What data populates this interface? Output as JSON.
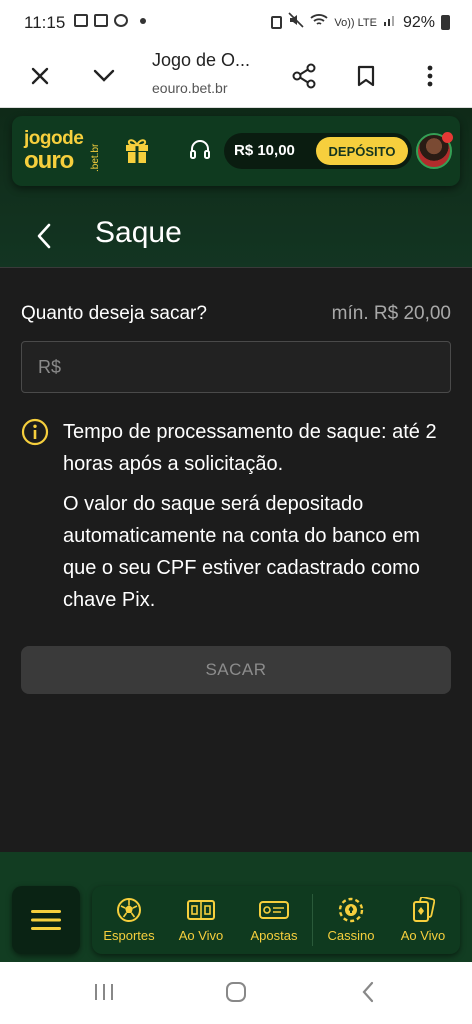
{
  "status_bar": {
    "time": "11:15",
    "battery": "92%",
    "volte": "Vo)) LTE"
  },
  "browser": {
    "title": "Jogo de O...",
    "url": "eouro.bet.br"
  },
  "header": {
    "logo_top": "jogode",
    "logo_bottom": "ouro",
    "logo_suffix": ".bet.br",
    "balance": "R$ 10,00",
    "deposit_label": "DEPÓSITO"
  },
  "page": {
    "title": "Saque"
  },
  "withdraw": {
    "question": "Quanto deseja sacar?",
    "minimum": "mín. R$ 20,00",
    "amount_placeholder": "R$",
    "info_processing": "Tempo de processamento de saque: até 2 horas após a solicitação.",
    "info_deposit": "O valor do saque será depositado automaticamente na conta do banco em que o seu CPF estiver cadastrado como chave Pix.",
    "submit_label": "SACAR"
  },
  "bottom_nav": {
    "items": [
      {
        "label": "Esportes",
        "icon": "soccer-ball-icon"
      },
      {
        "label": "Ao Vivo",
        "icon": "scoreboard-icon"
      },
      {
        "label": "Apostas",
        "icon": "ticket-icon"
      },
      {
        "label": "Cassino",
        "icon": "casino-chip-icon"
      },
      {
        "label": "Ao Vivo",
        "icon": "playing-cards-icon"
      }
    ]
  },
  "colors": {
    "brand_yellow": "#f6cf3d",
    "brand_green": "#0f3a1f",
    "background": "#1c1c1c"
  }
}
